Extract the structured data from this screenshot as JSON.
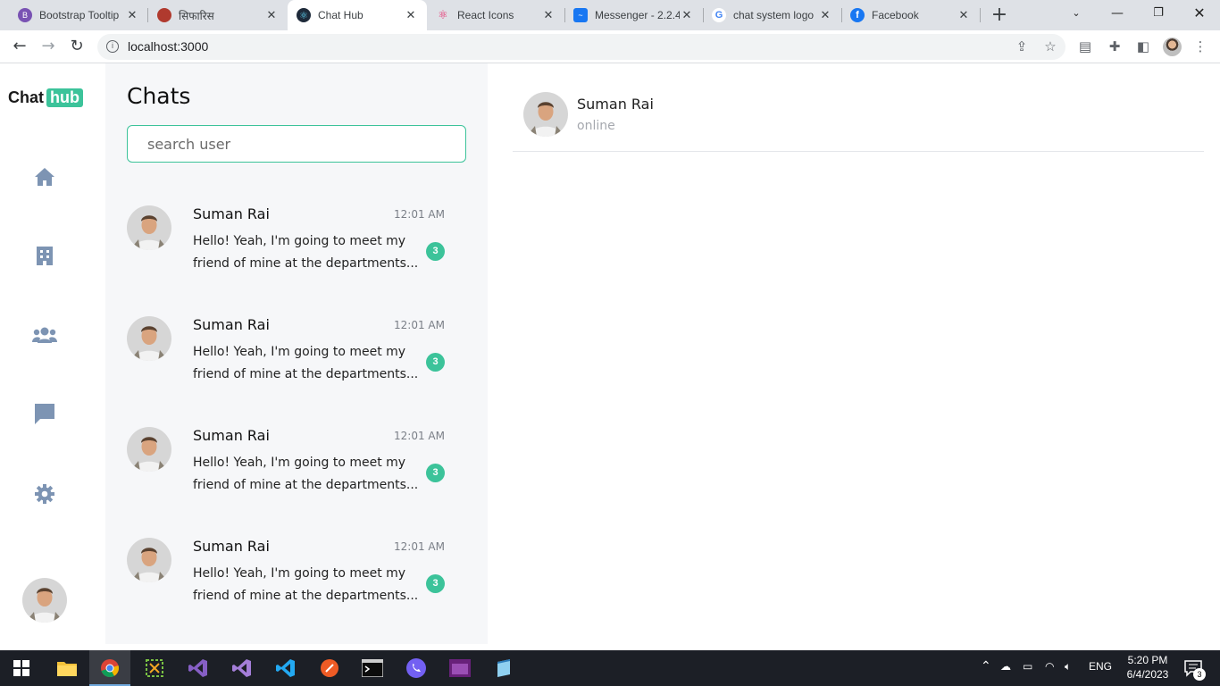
{
  "browser": {
    "tabs": [
      {
        "title": "Bootstrap Tooltip",
        "icon": "bootstrap-icon",
        "color": "#7952b3"
      },
      {
        "title": "सिफारिस",
        "icon": "nepal-gov-icon",
        "color": "#b03a2e"
      },
      {
        "title": "Chat Hub",
        "icon": "react-icon",
        "color": "#61dafb",
        "active": true
      },
      {
        "title": "React Icons",
        "icon": "react-icons-icon",
        "color": "#e91e63"
      },
      {
        "title": "Messenger - 2.2.4",
        "icon": "messenger-icon",
        "color": "#1877f2"
      },
      {
        "title": "chat system logo",
        "icon": "google-icon",
        "color": "#4285f4"
      },
      {
        "title": "Facebook",
        "icon": "facebook-icon",
        "color": "#1877f2"
      }
    ],
    "url": "localhost:3000"
  },
  "app": {
    "logo": {
      "part1": "Chat",
      "part2": "hub"
    },
    "nav_items": [
      "home-icon",
      "building-icon",
      "users-icon",
      "chat-icon",
      "settings-icon"
    ],
    "chats_title": "Chats",
    "search_placeholder": "search user",
    "chats": [
      {
        "name": "Suman Rai",
        "time": "12:01 AM",
        "message": "Hello! Yeah, I'm going to meet my friend of mine at the departments...",
        "unread": "3"
      },
      {
        "name": "Suman Rai",
        "time": "12:01 AM",
        "message": "Hello! Yeah, I'm going to meet my friend of mine at the departments...",
        "unread": "3"
      },
      {
        "name": "Suman Rai",
        "time": "12:01 AM",
        "message": "Hello! Yeah, I'm going to meet my friend of mine at the departments...",
        "unread": "3"
      },
      {
        "name": "Suman Rai",
        "time": "12:01 AM",
        "message": "Hello! Yeah, I'm going to meet my friend of mine at the departments...",
        "unread": "3"
      }
    ],
    "conversation": {
      "name": "Suman Rai",
      "status": "online"
    },
    "accent_color": "#3cc39a"
  },
  "taskbar": {
    "language": "ENG",
    "time": "5:20 PM",
    "date": "6/4/2023",
    "notifications": "3"
  }
}
